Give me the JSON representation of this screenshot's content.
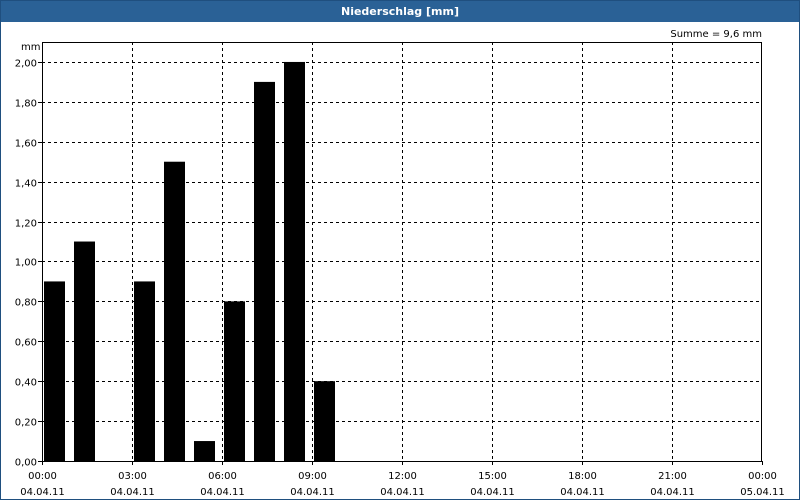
{
  "window": {
    "title": "Niederschlag [mm]"
  },
  "chart_data": {
    "type": "bar",
    "title": "Niederschlag [mm]",
    "ylabel": "mm",
    "annotation": "Summe = 9,6 mm",
    "ylim": [
      0,
      2.1
    ],
    "yticks": [
      "0,00",
      "0,20",
      "0,40",
      "0,60",
      "0,80",
      "1,00",
      "1,20",
      "1,40",
      "1,60",
      "1,80",
      "2,00"
    ],
    "xlim_hours": [
      0,
      24
    ],
    "xticks": [
      {
        "time": "00:00",
        "date": "04.04.11"
      },
      {
        "time": "03:00",
        "date": "04.04.11"
      },
      {
        "time": "06:00",
        "date": "04.04.11"
      },
      {
        "time": "09:00",
        "date": "04.04.11"
      },
      {
        "time": "12:00",
        "date": "04.04.11"
      },
      {
        "time": "15:00",
        "date": "04.04.11"
      },
      {
        "time": "18:00",
        "date": "04.04.11"
      },
      {
        "time": "21:00",
        "date": "04.04.11"
      },
      {
        "time": "00:00",
        "date": "05.04.11"
      }
    ],
    "grid": true,
    "bar_color": "#000000",
    "series": [
      {
        "x_hours": [
          0,
          1,
          2,
          3,
          4,
          5,
          6,
          7,
          8,
          9
        ],
        "values": [
          0.9,
          1.1,
          0.0,
          0.9,
          1.5,
          0.1,
          0.8,
          1.9,
          2.0,
          0.4
        ]
      }
    ]
  }
}
